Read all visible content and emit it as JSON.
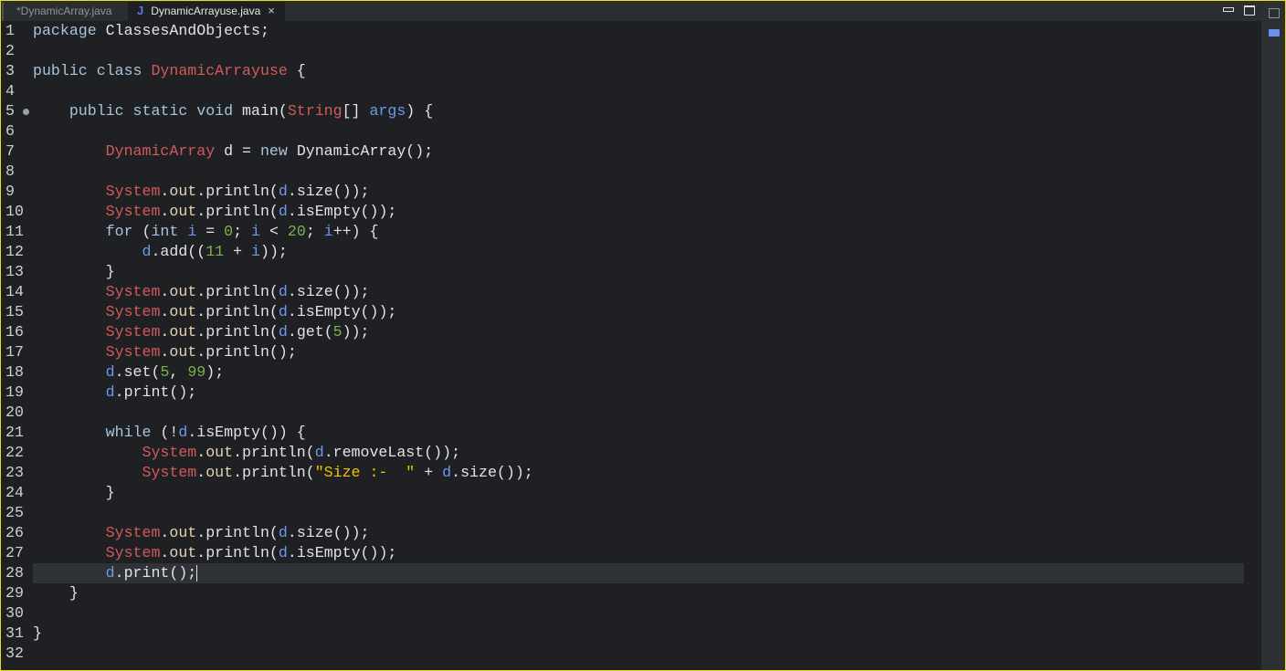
{
  "tabs": [
    {
      "label": "*DynamicArray.java",
      "active": false
    },
    {
      "label": "DynamicArrayuse.java",
      "active": true,
      "icon": "J"
    }
  ],
  "tab_close": "×",
  "code": [
    [
      [
        "package ",
        "kw"
      ],
      [
        "ClassesAndObjects;",
        "txt"
      ]
    ],
    [],
    [
      [
        "public class ",
        "kw"
      ],
      [
        "DynamicArrayuse",
        "cls"
      ],
      [
        " {",
        "txt"
      ]
    ],
    [],
    [
      [
        "    public static void ",
        "kw"
      ],
      [
        "main(",
        "txt"
      ],
      [
        "String",
        "cls"
      ],
      [
        "[] ",
        "txt"
      ],
      [
        "args",
        "var"
      ],
      [
        ") {",
        "txt"
      ]
    ],
    [],
    [
      [
        "        ",
        "txt"
      ],
      [
        "DynamicArray",
        "cls"
      ],
      [
        " d = ",
        "txt"
      ],
      [
        "new ",
        "kw"
      ],
      [
        "DynamicArray();",
        "txt"
      ]
    ],
    [],
    [
      [
        "        ",
        "txt"
      ],
      [
        "System",
        "cls"
      ],
      [
        ".",
        "txt"
      ],
      [
        "out",
        "fld"
      ],
      [
        ".println(",
        "txt"
      ],
      [
        "d",
        "var"
      ],
      [
        ".size());",
        "txt"
      ]
    ],
    [
      [
        "        ",
        "txt"
      ],
      [
        "System",
        "cls"
      ],
      [
        ".",
        "txt"
      ],
      [
        "out",
        "fld"
      ],
      [
        ".println(",
        "txt"
      ],
      [
        "d",
        "var"
      ],
      [
        ".isEmpty());",
        "txt"
      ]
    ],
    [
      [
        "        for ",
        "kw"
      ],
      [
        "(",
        "txt"
      ],
      [
        "int ",
        "kw"
      ],
      [
        "i",
        "var"
      ],
      [
        " = ",
        "txt"
      ],
      [
        "0",
        "num"
      ],
      [
        "; ",
        "txt"
      ],
      [
        "i",
        "var"
      ],
      [
        " < ",
        "txt"
      ],
      [
        "20",
        "num"
      ],
      [
        "; ",
        "txt"
      ],
      [
        "i",
        "var"
      ],
      [
        "++) {",
        "txt"
      ]
    ],
    [
      [
        "            ",
        "txt"
      ],
      [
        "d",
        "var"
      ],
      [
        ".add((",
        "txt"
      ],
      [
        "11",
        "num"
      ],
      [
        " + ",
        "txt"
      ],
      [
        "i",
        "var"
      ],
      [
        "));",
        "txt"
      ]
    ],
    [
      [
        "        }",
        "txt"
      ]
    ],
    [
      [
        "        ",
        "txt"
      ],
      [
        "System",
        "cls"
      ],
      [
        ".",
        "txt"
      ],
      [
        "out",
        "fld"
      ],
      [
        ".println(",
        "txt"
      ],
      [
        "d",
        "var"
      ],
      [
        ".size());",
        "txt"
      ]
    ],
    [
      [
        "        ",
        "txt"
      ],
      [
        "System",
        "cls"
      ],
      [
        ".",
        "txt"
      ],
      [
        "out",
        "fld"
      ],
      [
        ".println(",
        "txt"
      ],
      [
        "d",
        "var"
      ],
      [
        ".isEmpty());",
        "txt"
      ]
    ],
    [
      [
        "        ",
        "txt"
      ],
      [
        "System",
        "cls"
      ],
      [
        ".",
        "txt"
      ],
      [
        "out",
        "fld"
      ],
      [
        ".println(",
        "txt"
      ],
      [
        "d",
        "var"
      ],
      [
        ".get(",
        "txt"
      ],
      [
        "5",
        "num"
      ],
      [
        "));",
        "txt"
      ]
    ],
    [
      [
        "        ",
        "txt"
      ],
      [
        "System",
        "cls"
      ],
      [
        ".",
        "txt"
      ],
      [
        "out",
        "fld"
      ],
      [
        ".println();",
        "txt"
      ]
    ],
    [
      [
        "        ",
        "txt"
      ],
      [
        "d",
        "var"
      ],
      [
        ".set(",
        "txt"
      ],
      [
        "5",
        "num"
      ],
      [
        ", ",
        "txt"
      ],
      [
        "99",
        "num"
      ],
      [
        ");",
        "txt"
      ]
    ],
    [
      [
        "        ",
        "txt"
      ],
      [
        "d",
        "var"
      ],
      [
        ".print();",
        "txt"
      ]
    ],
    [],
    [
      [
        "        while ",
        "kw"
      ],
      [
        "(!",
        "txt"
      ],
      [
        "d",
        "var"
      ],
      [
        ".isEmpty()) {",
        "txt"
      ]
    ],
    [
      [
        "            ",
        "txt"
      ],
      [
        "System",
        "cls"
      ],
      [
        ".",
        "txt"
      ],
      [
        "out",
        "fld"
      ],
      [
        ".println(",
        "txt"
      ],
      [
        "d",
        "var"
      ],
      [
        ".removeLast());",
        "txt"
      ]
    ],
    [
      [
        "            ",
        "txt"
      ],
      [
        "System",
        "cls"
      ],
      [
        ".",
        "txt"
      ],
      [
        "out",
        "fld"
      ],
      [
        ".println(",
        "txt"
      ],
      [
        "\"Size :-  \"",
        "str"
      ],
      [
        " + ",
        "txt"
      ],
      [
        "d",
        "var"
      ],
      [
        ".size());",
        "txt"
      ]
    ],
    [
      [
        "        }",
        "txt"
      ]
    ],
    [],
    [
      [
        "        ",
        "txt"
      ],
      [
        "System",
        "cls"
      ],
      [
        ".",
        "txt"
      ],
      [
        "out",
        "fld"
      ],
      [
        ".println(",
        "txt"
      ],
      [
        "d",
        "var"
      ],
      [
        ".size());",
        "txt"
      ]
    ],
    [
      [
        "        ",
        "txt"
      ],
      [
        "System",
        "cls"
      ],
      [
        ".",
        "txt"
      ],
      [
        "out",
        "fld"
      ],
      [
        ".println(",
        "txt"
      ],
      [
        "d",
        "var"
      ],
      [
        ".isEmpty());",
        "txt"
      ]
    ],
    [
      [
        "        ",
        "txt"
      ],
      [
        "d",
        "var"
      ],
      [
        ".print();",
        "txt"
      ]
    ],
    [
      [
        "    }",
        "txt"
      ]
    ],
    [],
    [
      [
        "}",
        "txt"
      ]
    ],
    []
  ],
  "current_line": 28
}
